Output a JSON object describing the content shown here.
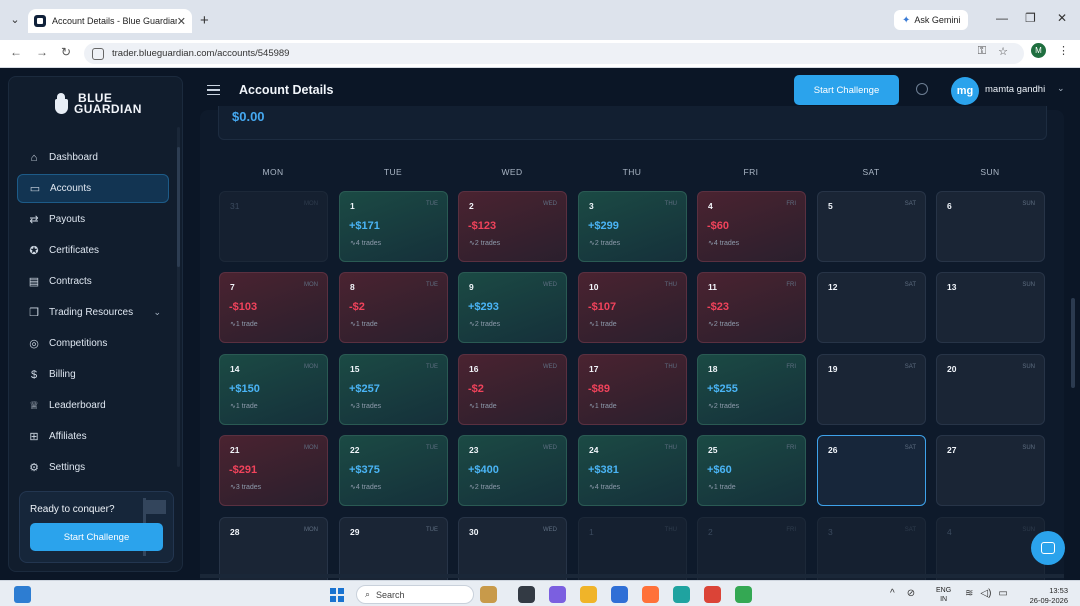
{
  "browser": {
    "tab_title": "Account Details - Blue Guardian",
    "tab_close": "✕",
    "new_tab": "+",
    "gemini_label": "Ask Gemini",
    "url": "trader.blueguardian.com/accounts/545989",
    "profile_initial": "M",
    "controls": {
      "minimize": "—",
      "restore": "❐",
      "close": "✕"
    },
    "nav": {
      "back": "←",
      "forward": "→",
      "reload": "↻"
    }
  },
  "brand": {
    "line1": "BLUE",
    "line2": "GUARDIAN"
  },
  "sidebar": {
    "items": [
      {
        "label": "Dashboard",
        "icon": "home-icon",
        "glyph": "⌂"
      },
      {
        "label": "Accounts",
        "icon": "card-icon",
        "glyph": "▭",
        "active": true
      },
      {
        "label": "Payouts",
        "icon": "payout-icon",
        "glyph": "⇄"
      },
      {
        "label": "Certificates",
        "icon": "certificate-icon",
        "glyph": "✪"
      },
      {
        "label": "Contracts",
        "icon": "contract-icon",
        "glyph": "▤"
      },
      {
        "label": "Trading Resources",
        "icon": "book-icon",
        "glyph": "❒",
        "chevron": "⌄"
      },
      {
        "label": "Competitions",
        "icon": "target-icon",
        "glyph": "◎"
      },
      {
        "label": "Billing",
        "icon": "dollar-icon",
        "glyph": "$"
      },
      {
        "label": "Leaderboard",
        "icon": "trophy-icon",
        "glyph": "♕"
      },
      {
        "label": "Affiliates",
        "icon": "gift-icon",
        "glyph": "⊞"
      },
      {
        "label": "Settings",
        "icon": "gear-icon",
        "glyph": "⚙"
      }
    ],
    "promo": {
      "title": "Ready to conquer?",
      "button": "Start Challenge"
    }
  },
  "header": {
    "title": "Account Details",
    "cta": "Start Challenge",
    "user_initials": "mg",
    "user_name": "mamta gandhi",
    "user_chevron": "⌄"
  },
  "balance": "$0.00",
  "calendar": {
    "weekdays": [
      "MON",
      "TUE",
      "WED",
      "THU",
      "FRI",
      "SAT",
      "SUN"
    ],
    "weeks": [
      [
        {
          "day": "31",
          "wd": "MON",
          "type": "out"
        },
        {
          "day": "1",
          "wd": "TUE",
          "type": "pos",
          "pnl": "+$171",
          "trades": "4 trades"
        },
        {
          "day": "2",
          "wd": "WED",
          "type": "neg",
          "pnl": "-$123",
          "trades": "2 trades"
        },
        {
          "day": "3",
          "wd": "THU",
          "type": "pos",
          "pnl": "+$299",
          "trades": "2 trades"
        },
        {
          "day": "4",
          "wd": "FRI",
          "type": "neg",
          "pnl": "-$60",
          "trades": "4 trades"
        },
        {
          "day": "5",
          "wd": "SAT",
          "type": "empty"
        },
        {
          "day": "6",
          "wd": "SUN",
          "type": "empty"
        }
      ],
      [
        {
          "day": "7",
          "wd": "MON",
          "type": "neg",
          "pnl": "-$103",
          "trades": "1 trade"
        },
        {
          "day": "8",
          "wd": "TUE",
          "type": "neg",
          "pnl": "-$2",
          "trades": "1 trade"
        },
        {
          "day": "9",
          "wd": "WED",
          "type": "pos",
          "pnl": "+$293",
          "trades": "2 trades"
        },
        {
          "day": "10",
          "wd": "THU",
          "type": "neg",
          "pnl": "-$107",
          "trades": "1 trade"
        },
        {
          "day": "11",
          "wd": "FRI",
          "type": "neg",
          "pnl": "-$23",
          "trades": "2 trades"
        },
        {
          "day": "12",
          "wd": "SAT",
          "type": "empty"
        },
        {
          "day": "13",
          "wd": "SUN",
          "type": "empty"
        }
      ],
      [
        {
          "day": "14",
          "wd": "MON",
          "type": "pos",
          "pnl": "+$150",
          "trades": "1 trade"
        },
        {
          "day": "15",
          "wd": "TUE",
          "type": "pos",
          "pnl": "+$257",
          "trades": "3 trades"
        },
        {
          "day": "16",
          "wd": "WED",
          "type": "neg",
          "pnl": "-$2",
          "trades": "1 trade"
        },
        {
          "day": "17",
          "wd": "THU",
          "type": "neg",
          "pnl": "-$89",
          "trades": "1 trade"
        },
        {
          "day": "18",
          "wd": "FRI",
          "type": "pos",
          "pnl": "+$255",
          "trades": "2 trades"
        },
        {
          "day": "19",
          "wd": "SAT",
          "type": "empty"
        },
        {
          "day": "20",
          "wd": "SUN",
          "type": "empty"
        }
      ],
      [
        {
          "day": "21",
          "wd": "MON",
          "type": "neg",
          "pnl": "-$291",
          "trades": "3 trades"
        },
        {
          "day": "22",
          "wd": "TUE",
          "type": "pos",
          "pnl": "+$375",
          "trades": "4 trades"
        },
        {
          "day": "23",
          "wd": "WED",
          "type": "pos",
          "pnl": "+$400",
          "trades": "2 trades"
        },
        {
          "day": "24",
          "wd": "THU",
          "type": "pos",
          "pnl": "+$381",
          "trades": "4 trades"
        },
        {
          "day": "25",
          "wd": "FRI",
          "type": "pos",
          "pnl": "+$60",
          "trades": "1 trade"
        },
        {
          "day": "26",
          "wd": "SAT",
          "type": "today"
        },
        {
          "day": "27",
          "wd": "SUN",
          "type": "empty"
        }
      ],
      [
        {
          "day": "28",
          "wd": "MON",
          "type": "empty"
        },
        {
          "day": "29",
          "wd": "TUE",
          "type": "empty"
        },
        {
          "day": "30",
          "wd": "WED",
          "type": "empty"
        },
        {
          "day": "1",
          "wd": "THU",
          "type": "out"
        },
        {
          "day": "2",
          "wd": "FRI",
          "type": "out"
        },
        {
          "day": "3",
          "wd": "SAT",
          "type": "out"
        },
        {
          "day": "4",
          "wd": "SUN",
          "type": "out"
        }
      ]
    ]
  },
  "taskbar": {
    "search": "Search",
    "lang_line1": "ENG",
    "lang_line2": "IN",
    "time": "13:53",
    "date": "26-09-2026",
    "tray_glyphs": [
      "^",
      "⊘"
    ],
    "apps": [
      {
        "name": "widgets-app-icon",
        "color": "#c89a4a"
      },
      {
        "name": "taskview-app-icon",
        "color": "#333a44"
      },
      {
        "name": "copilot-app-icon",
        "color": "#7b5fe0"
      },
      {
        "name": "explorer-app-icon",
        "color": "#f0b429"
      },
      {
        "name": "store-app-icon",
        "color": "#2f6fd6"
      },
      {
        "name": "firefox-app-icon",
        "color": "#ff7139"
      },
      {
        "name": "edge-app-icon",
        "color": "#1fa3a0"
      },
      {
        "name": "chrome-app-icon",
        "color": "#db4437"
      },
      {
        "name": "chrome-alt-app-icon",
        "color": "#34a853"
      }
    ]
  }
}
